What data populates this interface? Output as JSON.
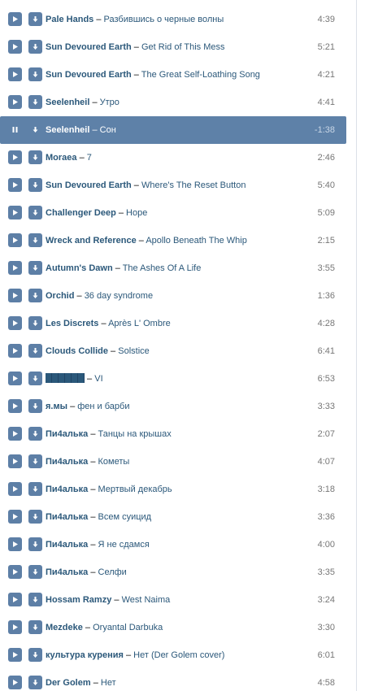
{
  "colors": {
    "button": "#5d7fa6",
    "link": "#2b587a",
    "active_row": "#5e81a8",
    "duration": "#777777"
  },
  "icons": {
    "play": "play-icon",
    "pause": "pause-icon",
    "download": "download-arrow-icon"
  },
  "tracks": [
    {
      "artist": "Pale Hands",
      "sep": " – ",
      "title": "Разбившись о черные волны",
      "duration": "4:39"
    },
    {
      "artist": "Sun Devoured Earth",
      "sep": " – ",
      "title": "Get Rid of This Mess",
      "duration": "5:21"
    },
    {
      "artist": "Sun Devoured Earth",
      "sep": " – ",
      "title": "The Great Self-Loathing Song",
      "duration": "4:21"
    },
    {
      "artist": "Seelenheil",
      "sep": " – ",
      "title": "Утро",
      "duration": "4:41"
    },
    {
      "artist": "Seelenheil",
      "sep": " – ",
      "title": "Сон",
      "duration": "-1:38",
      "active": true
    },
    {
      "artist": "Moraea",
      "sep": " – ",
      "title": "7",
      "duration": "2:46"
    },
    {
      "artist": "Sun Devoured Earth",
      "sep": " – ",
      "title": "Where's The Reset Button",
      "duration": "5:40"
    },
    {
      "artist": "Challenger Deep",
      "sep": " – ",
      "title": "Hope",
      "duration": "5:09"
    },
    {
      "artist": "Wreck and Reference",
      "sep": " – ",
      "title": "Apollo Beneath The Whip",
      "duration": "2:15"
    },
    {
      "artist": "Autumn's Dawn",
      "sep": " – ",
      "title": "The Ashes Of A Life",
      "duration": "3:55"
    },
    {
      "artist": "Orchid",
      "sep": " – ",
      "title": "36 day syndrome",
      "duration": "1:36"
    },
    {
      "artist": "Les Discrets",
      "sep": " – ",
      "title": "Après L' Ombre",
      "duration": "4:28"
    },
    {
      "artist": "Clouds Collide",
      "sep": " – ",
      "title": "Solstice",
      "duration": "6:41"
    },
    {
      "artist": "",
      "censored": true,
      "sep": " – ",
      "title": "VI",
      "duration": "6:53"
    },
    {
      "artist": "я.мы",
      "sep": " – ",
      "title": "фен и барби",
      "duration": "3:33"
    },
    {
      "artist": "Пи4алька",
      "sep": " – ",
      "title": "Танцы на крышах",
      "duration": "2:07"
    },
    {
      "artist": "Пи4алька",
      "sep": " – ",
      "title": "Кометы",
      "duration": "4:07"
    },
    {
      "artist": "Пи4алька",
      "sep": " – ",
      "title": "Мертвый декабрь",
      "duration": "3:18"
    },
    {
      "artist": "Пи4алька",
      "sep": " – ",
      "title": "Всем суицид",
      "duration": "3:36"
    },
    {
      "artist": "Пи4алька",
      "sep": " – ",
      "title": "Я не сдамся",
      "duration": "4:00"
    },
    {
      "artist": "Пи4алька",
      "sep": " – ",
      "title": "Селфи",
      "duration": "3:35"
    },
    {
      "artist": "Hossam Ramzy",
      "sep": " – ",
      "title": "West Naima",
      "duration": "3:24"
    },
    {
      "artist": "Mezdeke",
      "sep": " – ",
      "title": "Oryantal Darbuka",
      "duration": "3:30"
    },
    {
      "artist": "культура курения",
      "sep": " – ",
      "title": "Нет (Der Golem cover)",
      "duration": "6:01"
    },
    {
      "artist": "Der Golem",
      "sep": " – ",
      "title": "Нет",
      "duration": "4:58"
    }
  ]
}
